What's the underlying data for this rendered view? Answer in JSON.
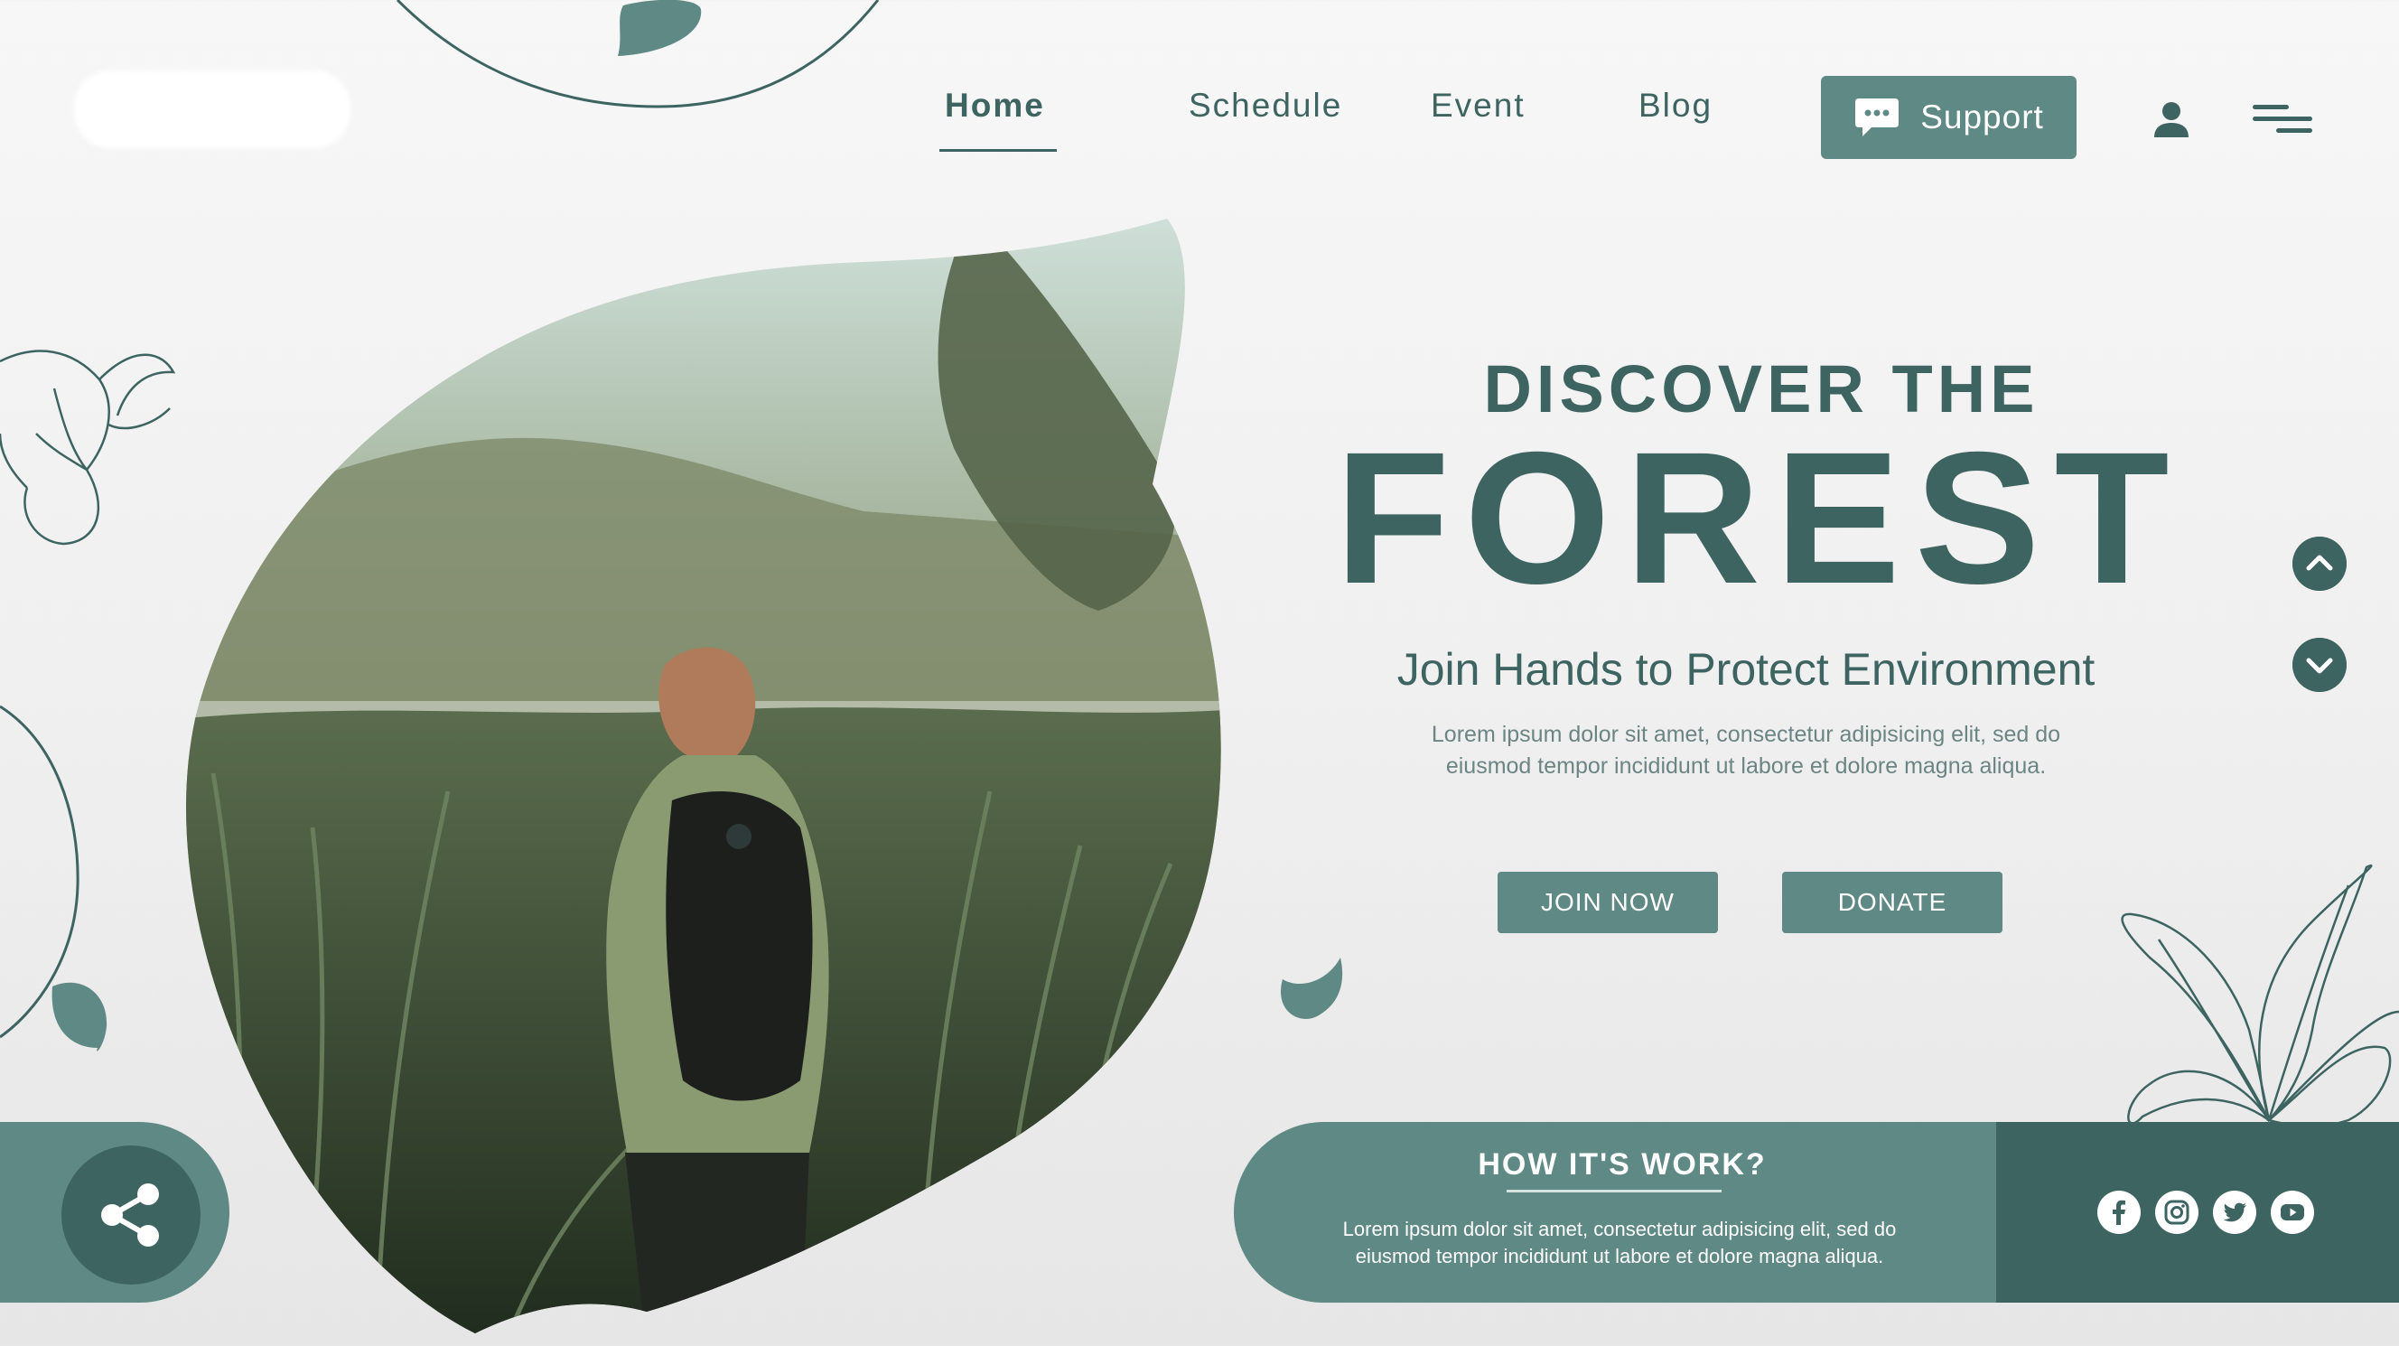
{
  "nav": {
    "home": "Home",
    "schedule": "Schedule",
    "event": "Event",
    "blog": "Blog",
    "support": "Support"
  },
  "hero": {
    "discover": "DISCOVER THE",
    "forest": "FOREST",
    "tagline": "Join Hands to Protect Environment",
    "body": "Lorem ipsum dolor sit amet, consectetur adipisicing elit, sed do eiusmod tempor incididunt ut labore et dolore magna aliqua.",
    "join_label": "JOIN NOW",
    "donate_label": "DONATE"
  },
  "how": {
    "title": "HOW IT'S WORK?",
    "body": "Lorem ipsum dolor sit amet, consectetur adipisicing elit, sed do eiusmod tempor incididunt ut labore et dolore magna aliqua."
  },
  "icons": {
    "support": "chat-icon",
    "user": "user-icon",
    "menu": "menu-icon",
    "share": "share-icon",
    "up": "chevron-up-icon",
    "down": "chevron-down-icon",
    "social": [
      "facebook-icon",
      "instagram-icon",
      "twitter-icon",
      "youtube-icon"
    ]
  },
  "colors": {
    "primary": "#3d6460",
    "accent": "#5f8985",
    "background": "#f2f2f2"
  }
}
